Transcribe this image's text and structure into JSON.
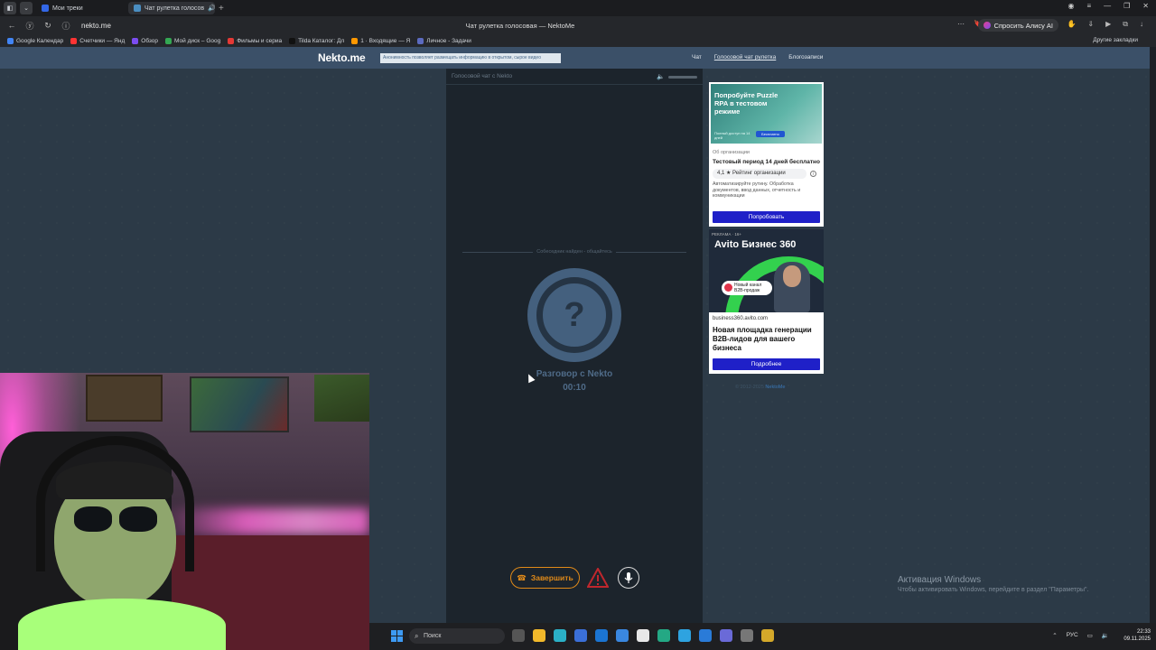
{
  "browser": {
    "tabs": [
      {
        "label": "Мои треки",
        "favicon_color": "#3367e6"
      },
      {
        "label": "Чат рулетка голосов",
        "favicon_color": "#4a8ec2"
      }
    ],
    "new_tab_icon": "plus-icon",
    "url": "nekto.me",
    "page_title": "Чат рулетка голосовая — NektoMe",
    "alice_label": "Спросить Алису AI",
    "bookmarks": [
      {
        "label": "Google Календар",
        "color": "#4285f4"
      },
      {
        "label": "Счетчики — Янд",
        "color": "#ff3333"
      },
      {
        "label": "Обзор",
        "color": "#7b4df0"
      },
      {
        "label": "Мой диск – Goog",
        "color": "#34a853"
      },
      {
        "label": "Фильмы и сериа",
        "color": "#e53935"
      },
      {
        "label": "Tilda Каталог: Дл",
        "color": "#111111"
      },
      {
        "label": "1 · Входящие — Я",
        "color": "#ff9800"
      },
      {
        "label": "Личное - Задачи",
        "color": "#5c6bc0"
      }
    ],
    "other_bookmarks": "Другие закладки"
  },
  "site": {
    "logo": "Nekto.me",
    "notice": "Анонимность позволяет размещать информацию в открытом, сырое видео",
    "nav": [
      "Чат",
      "Голосовой чат рулетка",
      "Блогозаписи"
    ]
  },
  "chat": {
    "header": "Голосовой чат с Nekto",
    "divider_text": "Собеседник найден - общайтесь",
    "avatar_symbol": "?",
    "talk_title": "Разговор с Nekto",
    "timer": "00:10",
    "end_label": "Завершить"
  },
  "ads": {
    "ad1": {
      "banner_text": "Попробуйте Puzzle RPA в тестовом режиме",
      "banner_small": "Полный доступ на 14 дней",
      "banner_btn": "Бесплатно",
      "org_label": "Об организации",
      "trial": "Тестовый период 14 дней бесплатно",
      "rating": "4,1 ★ Рейтинг организации",
      "info_icon": "i",
      "description": "Автоматизируйте рутину. Обработка документов, ввод данных, отчетность и коммуникации",
      "button": "Попробовать"
    },
    "ad2": {
      "ad_label": "РЕКЛАМА · 16+",
      "brand": "Avito Бизнес 360",
      "tag": "Новый канал B2B-продаж",
      "domain": "business360.avito.com",
      "headline": "Новая площадка генерации B2B-лидов для вашего бизнеса",
      "button": "Подробнее"
    },
    "copyright": "© 2012-2025",
    "copyright_link": "NektoMe"
  },
  "taskbar": {
    "search": "Поиск",
    "lang": "РУС",
    "time": "22:33",
    "date": "09.11.2025"
  },
  "watermark": {
    "title": "Активация Windows",
    "subtitle": "Чтобы активировать Windows, перейдите в раздел \"Параметры\"."
  }
}
